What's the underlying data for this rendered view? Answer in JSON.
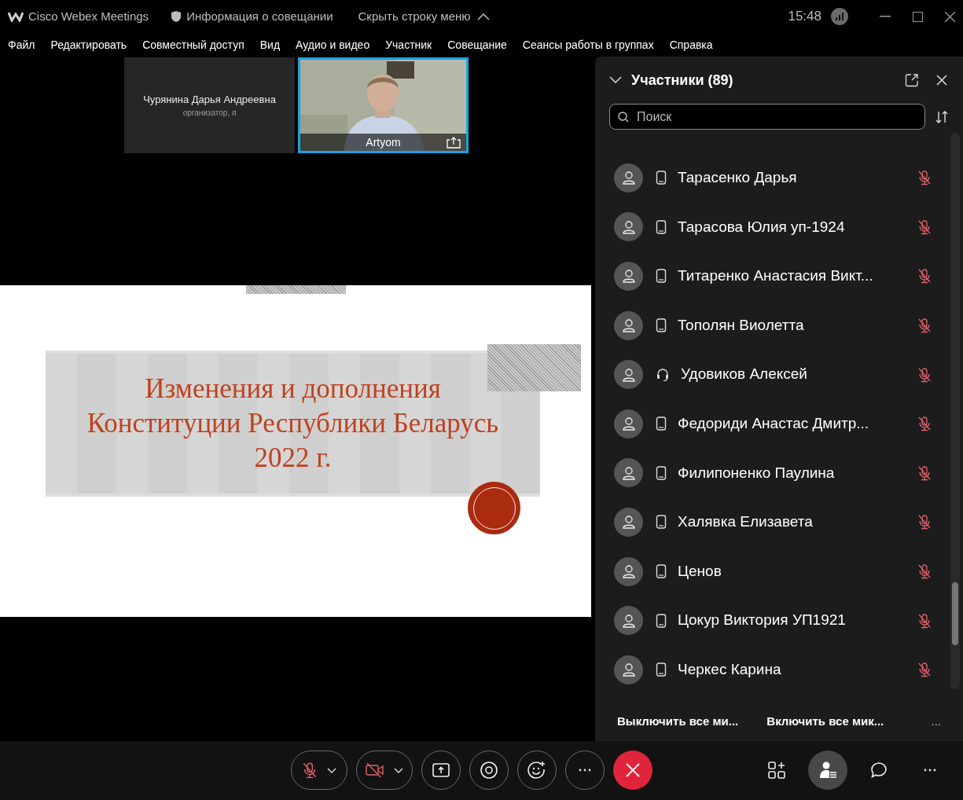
{
  "title_bar": {
    "app_title": "Cisco Webex Meetings",
    "meeting_info": "Информация о совещании",
    "hide_menu": "Скрыть строку меню",
    "time": "15:48"
  },
  "menu": [
    "Файл",
    "Редактировать",
    "Совместный доступ",
    "Вид",
    "Аудио и видео",
    "Участник",
    "Совещание",
    "Сеансы работы в группах",
    "Справка"
  ],
  "tiles": [
    {
      "kind": "name",
      "name": "Чурянина Дарья Андреевна",
      "role": "организатор, я",
      "selected": false
    },
    {
      "kind": "video",
      "name": "Artyom",
      "selected": true
    }
  ],
  "slide": {
    "title_lines": [
      "Изменения и дополнения",
      "Конституции Республики Беларусь",
      "2022 г."
    ]
  },
  "participants_panel": {
    "title": "Участники (89)",
    "expanded": true,
    "search": {
      "placeholder": "Поиск"
    },
    "participants": [
      {
        "name": "Тарасенко Дарья",
        "kind": "phone",
        "muted": true
      },
      {
        "name": "Тарасова Юлия уп-1924",
        "kind": "phone",
        "muted": true
      },
      {
        "name": "Титаренко Анастасия Викт...",
        "kind": "phone",
        "muted": true
      },
      {
        "name": "Тополян Виолетта",
        "kind": "phone",
        "muted": true
      },
      {
        "name": "Удовиков Алексей",
        "kind": "headset",
        "muted": true
      },
      {
        "name": "Федориди Анастас Дмитр...",
        "kind": "phone",
        "muted": true
      },
      {
        "name": "Филипоненко Паулина",
        "kind": "phone",
        "muted": true
      },
      {
        "name": "Халявка Елизавета",
        "kind": "phone",
        "muted": true
      },
      {
        "name": "Ценов",
        "kind": "phone",
        "muted": true
      },
      {
        "name": "Цокур Виктория УП1921",
        "kind": "phone",
        "muted": true
      },
      {
        "name": "Черкес Карина",
        "kind": "phone",
        "muted": true
      }
    ],
    "actions": [
      "Выключить все ми...",
      "Включить все мик...",
      "..."
    ]
  },
  "toolbar": {
    "center": [
      {
        "kind": "mute"
      },
      {
        "kind": "video"
      },
      {
        "kind": "share"
      },
      {
        "kind": "record"
      },
      {
        "kind": "reactions"
      },
      {
        "kind": "more"
      },
      {
        "kind": "end"
      }
    ],
    "right": [
      {
        "kind": "apps",
        "selected": false
      },
      {
        "kind": "participants",
        "selected": true
      },
      {
        "kind": "chat",
        "selected": false
      },
      {
        "kind": "more",
        "selected": false
      }
    ]
  }
}
